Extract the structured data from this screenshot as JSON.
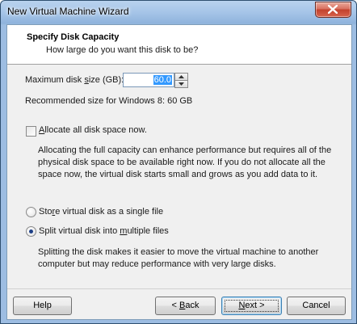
{
  "window": {
    "title": "New Virtual Machine Wizard"
  },
  "header": {
    "title": "Specify Disk Capacity",
    "subtitle": "How large do you want this disk to be?"
  },
  "disk_size": {
    "label_pre": "Maximum disk ",
    "label_u": "s",
    "label_post": "ize (GB):",
    "value": "60.0",
    "recommended": "Recommended size for Windows 8: 60 GB"
  },
  "allocate": {
    "label_u": "A",
    "label_post": "llocate all disk space now.",
    "checked": false,
    "description": [
      "Allocating the full capacity can enhance performance but requires all of the",
      "physical disk space to be available right now. If you do not allocate all the",
      "space now, the virtual disk starts small and grows as you add data to it."
    ]
  },
  "storage": {
    "single": {
      "label_pre": "Sto",
      "label_u": "r",
      "label_post": "e virtual disk as a single file",
      "selected": false
    },
    "split": {
      "label_pre": "Split virtual disk into ",
      "label_u": "m",
      "label_post": "ultiple files",
      "selected": true,
      "description": [
        "Splitting the disk makes it easier to move the virtual machine to another",
        "computer but may reduce performance with very large disks."
      ]
    }
  },
  "buttons": {
    "help": "Help",
    "back_pre": "< ",
    "back_u": "B",
    "back_post": "ack",
    "next_u": "N",
    "next_post": "ext >",
    "cancel": "Cancel"
  },
  "colors": {
    "accent_selection": "#3399ff",
    "close_button": "#c2412c"
  }
}
